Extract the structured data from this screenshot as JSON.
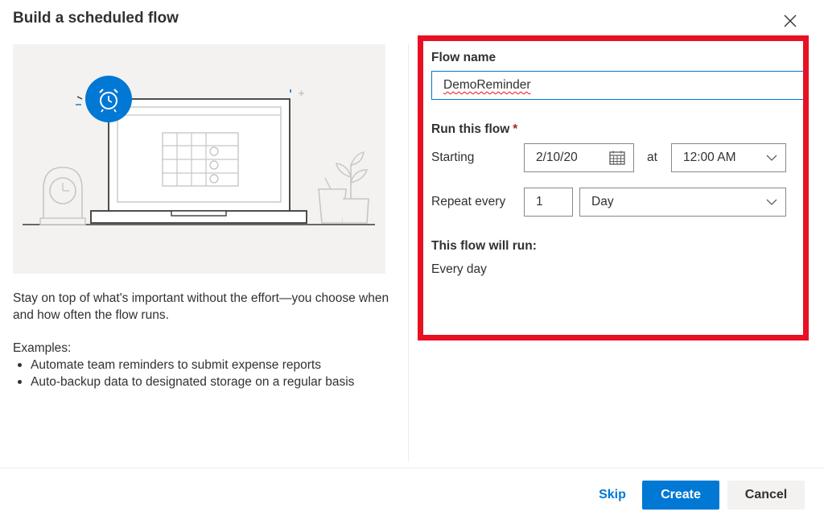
{
  "dialog": {
    "title": "Build a scheduled flow",
    "description": "Stay on top of what's important without the effort—you choose when and how often the flow runs.",
    "examples_heading": "Examples:",
    "examples": [
      "Automate team reminders to submit expense reports",
      "Auto-backup data to designated storage on a regular basis"
    ]
  },
  "form": {
    "flow_name_label": "Flow name",
    "flow_name_value": "DemoReminder",
    "run_label": "Run this flow",
    "required_mark": "*",
    "starting_label": "Starting",
    "start_date": "2/10/20",
    "at_label": "at",
    "start_time": "12:00 AM",
    "repeat_label": "Repeat every",
    "repeat_interval": "1",
    "repeat_unit": "Day",
    "summary_label": "This flow will run:",
    "summary_value": "Every day"
  },
  "footer": {
    "skip_label": "Skip",
    "create_label": "Create",
    "cancel_label": "Cancel"
  },
  "icons": {
    "close": "close-icon",
    "calendar": "calendar-icon",
    "chevron": "chevron-down-icon",
    "alarm": "alarm-clock-icon"
  },
  "colors": {
    "accent": "#0078d4",
    "highlight": "#e81123",
    "text": "#323130",
    "illustration_bg": "#f3f2f1"
  }
}
